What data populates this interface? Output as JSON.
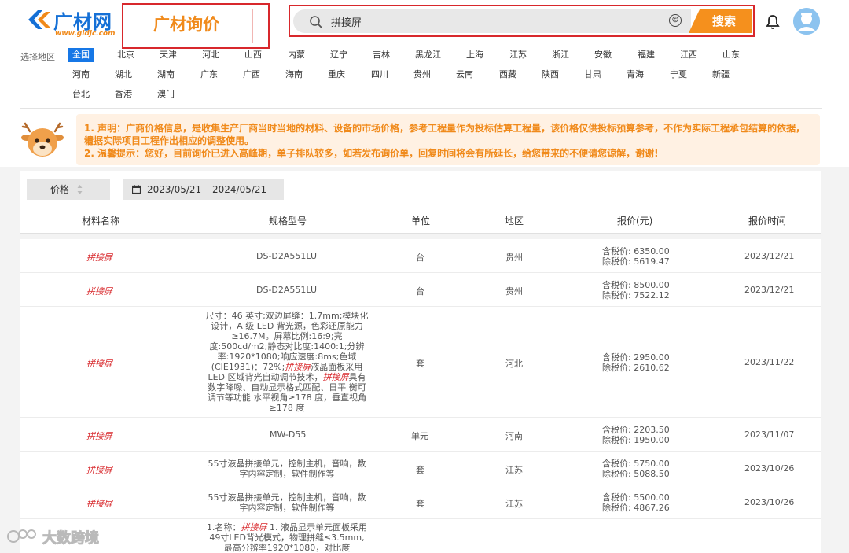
{
  "header": {
    "logo_text": "广材网",
    "logo_url": "www.gldjc.com",
    "page_title": "广材询价",
    "search": {
      "value": "拼接屏",
      "button_label": "搜索"
    }
  },
  "region": {
    "label": "选择地区",
    "items": [
      "全国",
      "北京",
      "天津",
      "河北",
      "山西",
      "内蒙",
      "辽宁",
      "吉林",
      "黑龙江",
      "上海",
      "江苏",
      "浙江",
      "安徽",
      "福建",
      "江西",
      "山东",
      "河南",
      "湖北",
      "湖南",
      "广东",
      "广西",
      "海南",
      "重庆",
      "四川",
      "贵州",
      "云南",
      "西藏",
      "陕西",
      "甘肃",
      "青海",
      "宁夏",
      "新疆",
      "台北",
      "香港",
      "澳门"
    ],
    "active": "全国"
  },
  "notice": {
    "line1a": "1. 声明：广商价格信息，是收集生产厂商当时当地的材料、设备的市场价格，参考工程量作为投标估算工程量，该价格仅供投标预算参考，不作为实际工程承包结算的依据，请",
    "line1b": "根据实际项目工程作出相应的调整使用。",
    "line2": "2. 温馨提示：您好，目前询价已进入高峰期，单子排队较多，如若发布询价单，回复时间将会有所延长，给您带来的不便请您谅解，谢谢!"
  },
  "filters": {
    "sort_label": "价格",
    "date_start": "2023/05/21",
    "date_sep": "-",
    "date_end": "2024/05/21"
  },
  "table": {
    "headers": [
      "材料名称",
      "规格型号",
      "单位",
      "地区",
      "报价(元)",
      "报价时间"
    ],
    "tax_incl_label": "含税价:",
    "tax_excl_label": "除税价:",
    "rows": [
      {
        "name": "拼接屏",
        "spec": "DS-D2A551LU",
        "unit": "台",
        "region": "贵州",
        "tax_incl": "6350.00",
        "tax_excl": "5619.47",
        "date": "2023/12/21"
      },
      {
        "name": "拼接屏",
        "spec": "DS-D2A551LU",
        "unit": "台",
        "region": "贵州",
        "tax_incl": "8500.00",
        "tax_excl": "7522.12",
        "date": "2023/12/21"
      },
      {
        "name": "拼接屏",
        "spec_lines": [
          "尺寸：46 英寸;双边屏缝：1.7mm;模块化",
          "设计，A 级 LED 背光源，色彩还原能力",
          "≥16.7M。屏幕比例:16:9;亮",
          "度:500cd/m2;静态对比度:1400:1;分辨",
          "率:1920*1080;响应速度:8ms;色域",
          "(CIE1931)：72%;"
        ],
        "spec_hl1": "拼接屏",
        "spec_mid1": "液晶面板采用",
        "spec_line7a": "LED 区域背光自动调节技术，",
        "spec_hl2": "拼接屏",
        "spec_line7b": "具有",
        "spec_tail": [
          "数字降噪、自动显示格式匹配、日平 衡可",
          "调节等功能 水平视角≥178 度，垂直视角",
          "≥178 度"
        ],
        "unit": "套",
        "region": "河北",
        "tax_incl": "2950.00",
        "tax_excl": "2610.62",
        "date": "2023/11/22"
      },
      {
        "name": "拼接屏",
        "spec": "MW-D55",
        "unit": "单元",
        "region": "河南",
        "tax_incl": "2203.50",
        "tax_excl": "1950.00",
        "date": "2023/11/07"
      },
      {
        "name": "拼接屏",
        "spec_lines": [
          "55寸液晶拼接单元，控制主机，音响，数",
          "字内容定制，软件制作等"
        ],
        "unit": "套",
        "region": "江苏",
        "tax_incl": "5750.00",
        "tax_excl": "5088.50",
        "date": "2023/10/26"
      },
      {
        "name": "拼接屏",
        "spec_lines": [
          "55寸液晶拼接单元，控制主机，音响，数",
          "字内容定制，软件制作等"
        ],
        "unit": "套",
        "region": "江苏",
        "tax_incl": "5500.00",
        "tax_excl": "4867.26",
        "date": "2023/10/26"
      },
      {
        "spec_prefix": "1.名称：",
        "spec_hl": "拼接屏",
        "spec_suffix": " 1. 液晶显示单元面板采用",
        "spec_lines": [
          "49寸LED背光模式，物理拼缝≤3.5mm,",
          "最高分辨率1920*1080，对比度"
        ]
      }
    ]
  },
  "watermark": {
    "text": "大数跨境"
  }
}
